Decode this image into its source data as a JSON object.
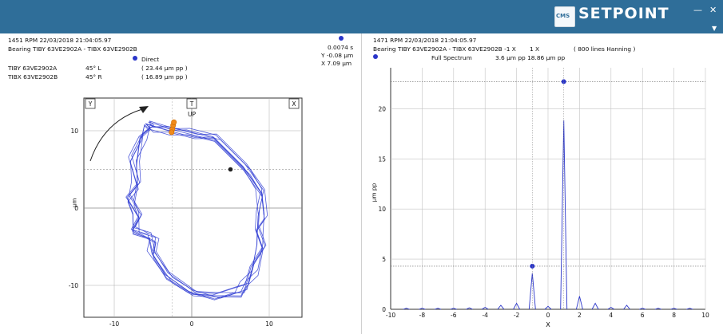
{
  "app": {
    "brand": "SETPOINT",
    "logo_text": "CMS",
    "window_controls": [
      "—",
      "✕"
    ],
    "collapse_icon": "chevron-down-icon"
  },
  "orbit_panel": {
    "header_line1": "1451 RPM   22/03/2018 21:04:05.97",
    "header_line2": "Bearing TIBY 63VE2902A - TIBX 63VE2902B",
    "legend_label": "Direct",
    "legend_color": "#2a35c9",
    "channels": [
      {
        "name": "TIBY 63VE2902A",
        "angle": "45° L",
        "value": "( 23.44 µm pp )"
      },
      {
        "name": "TIBX 63VE2902B",
        "angle": "45° R",
        "value": "( 16.89 µm pp )"
      }
    ],
    "cursor": {
      "time": "0.0074 s",
      "y": "Y  -0.08   µm",
      "x": "X  7.09   µm"
    },
    "axis_boxes": {
      "y": "Y",
      "t": "T",
      "x": "X"
    },
    "up_label": "UP",
    "ylabel": "µm",
    "x_ticks": [
      "-10",
      "0",
      "10"
    ],
    "y_ticks": [
      "10",
      "0",
      "-10"
    ]
  },
  "spectrum_panel": {
    "header_line1": "1471 RPM   22/03/2018 21:04:05.97",
    "header_line2": "Bearing TIBY 63VE2902A - TIBX 63VE2902B  -1 X",
    "header_1x": "1 X",
    "header_lines": "( 800 lines  Hanning )",
    "legend_label": "Full Spectrum",
    "legend_values": "3.6 µm pp   18.86 µm pp",
    "ylabel": "µm pp",
    "xlabel": "X"
  },
  "chart_data": [
    {
      "type": "scatter",
      "title": "",
      "xlabel": "",
      "ylabel": "µm",
      "xlim": [
        -14,
        14
      ],
      "ylim": [
        -14,
        14
      ],
      "series": [
        {
          "name": "Direct",
          "x": [
            -5.5,
            -3,
            0,
            3,
            5,
            7,
            9,
            9,
            8.5,
            9,
            8,
            7,
            6,
            3,
            0,
            -3,
            -5,
            -5,
            -7.5,
            -7,
            -8,
            -7,
            -7.5,
            -6.5,
            -5.5
          ],
          "y": [
            10.5,
            10,
            9.5,
            9,
            7,
            5,
            2,
            -1,
            -3,
            -5,
            -8,
            -10,
            -11,
            -11.5,
            -11,
            -9,
            -6,
            -4,
            -3,
            -1,
            1,
            3,
            6,
            9,
            10.5
          ]
        }
      ],
      "marker_keyphasor": {
        "x": -2.5,
        "y": 10.2
      },
      "marker_cursor": {
        "x": 5,
        "y": 5
      }
    },
    {
      "type": "bar",
      "title": "",
      "xlabel": "X",
      "ylabel": "µm pp",
      "xlim": [
        -10,
        10
      ],
      "ylim": [
        0,
        23
      ],
      "x_ticks": [
        -10,
        -8,
        -6,
        -4,
        -2,
        0,
        2,
        4,
        6,
        8,
        10
      ],
      "y_ticks": [
        0,
        5,
        10,
        15,
        20
      ],
      "series": [
        {
          "name": "Full Spectrum",
          "x": [
            -9,
            -8,
            -7,
            -6,
            -5,
            -4,
            -3,
            -2,
            -1,
            0,
            1,
            2,
            3,
            4,
            5,
            6,
            7,
            8,
            9
          ],
          "values": [
            0.1,
            0.1,
            0.1,
            0.1,
            0.15,
            0.2,
            0.4,
            0.6,
            3.6,
            0.3,
            18.86,
            1.3,
            0.6,
            0.2,
            0.4,
            0.1,
            0.1,
            0.1,
            0.1
          ]
        }
      ],
      "reference_lines": [
        22.7,
        4.3
      ]
    }
  ]
}
